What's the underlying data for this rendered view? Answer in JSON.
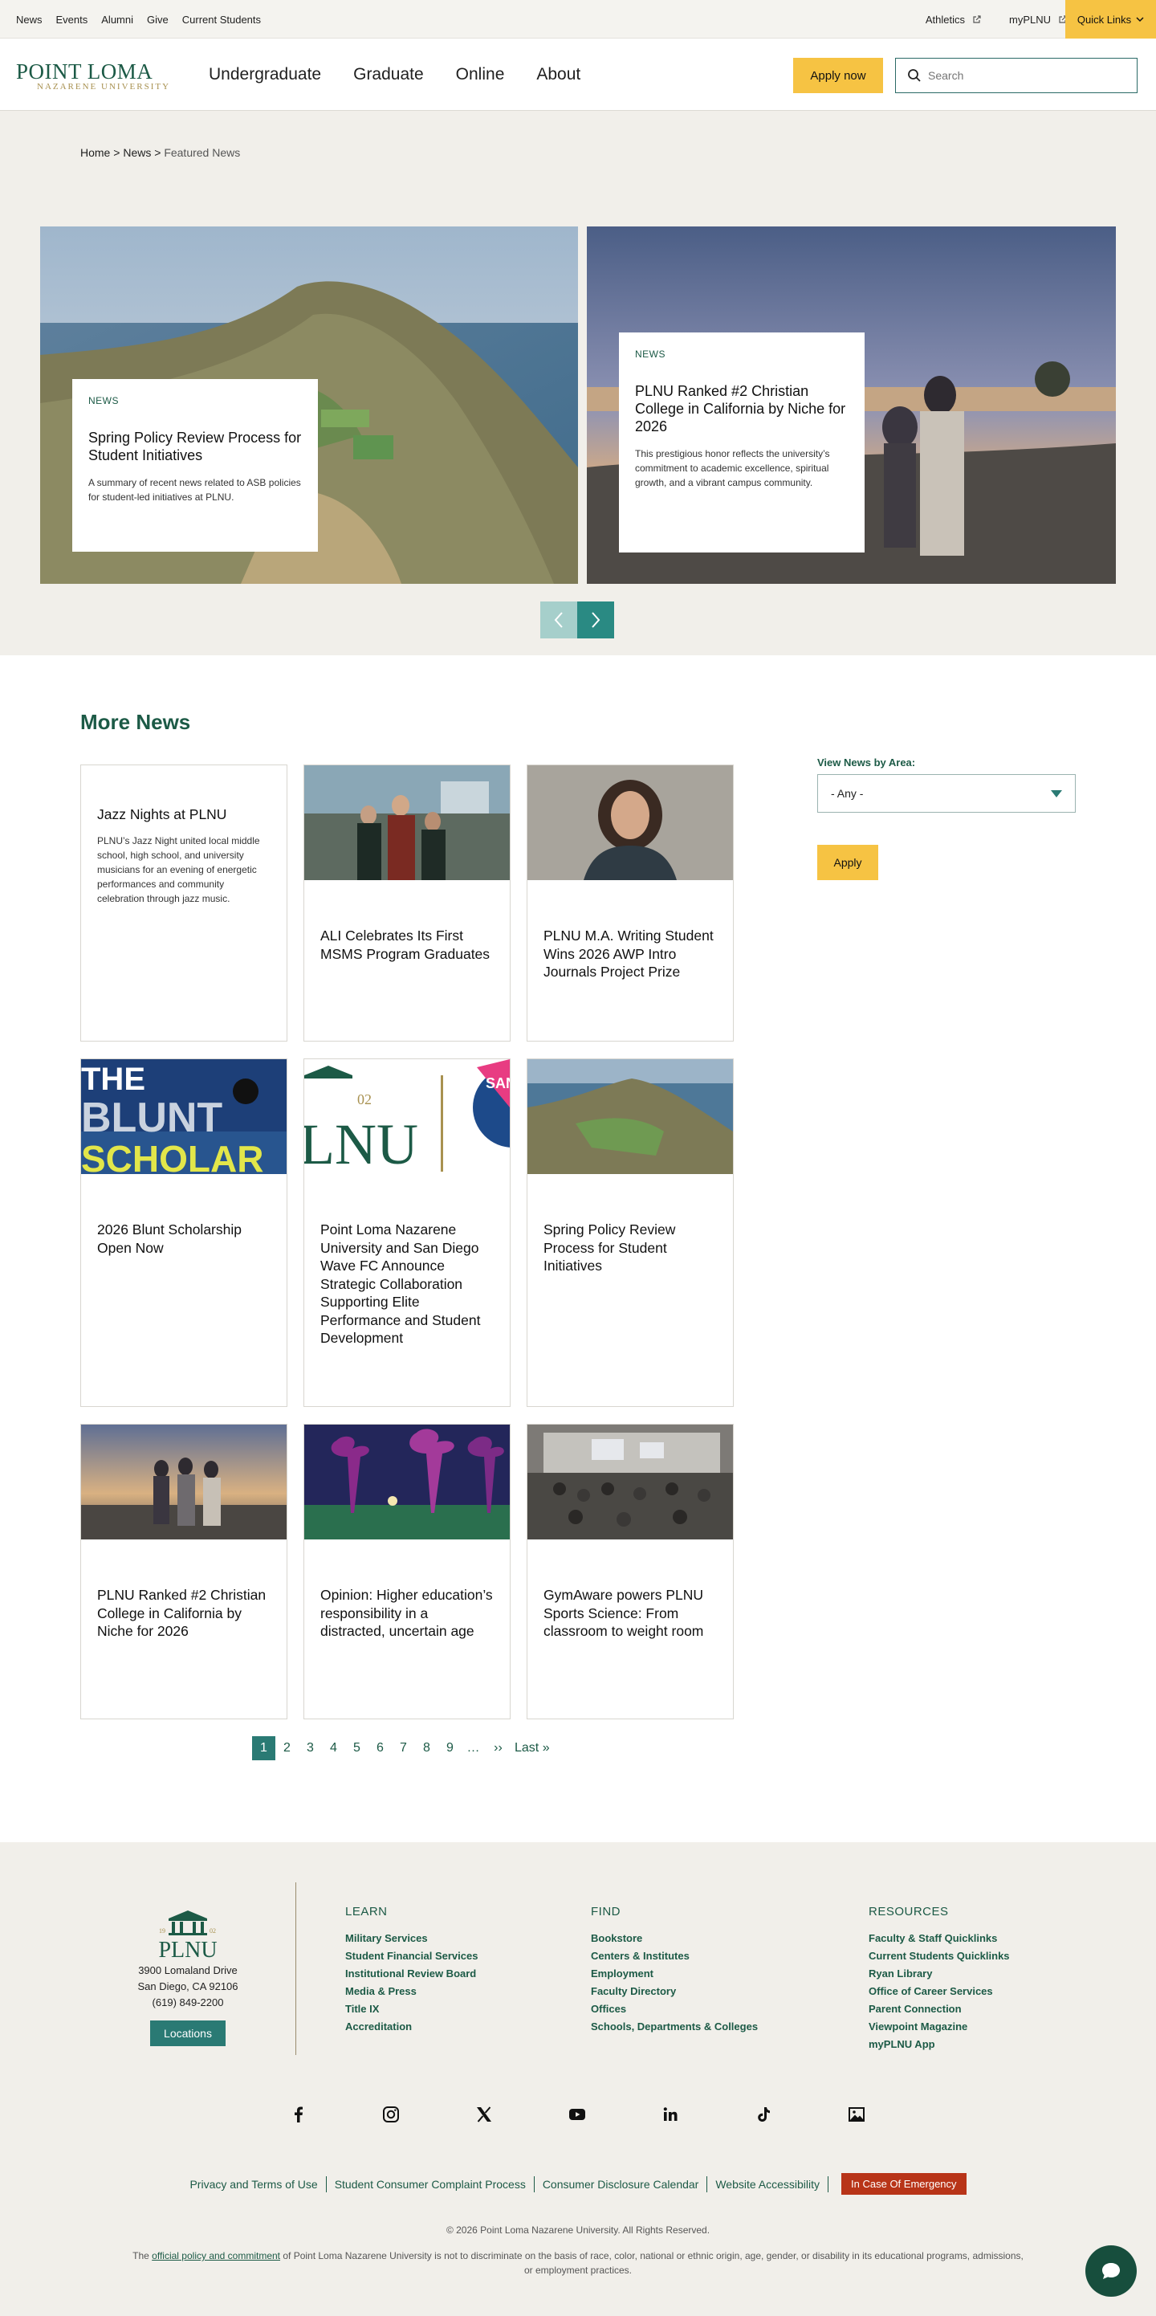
{
  "utility": {
    "links": [
      "News",
      "Events",
      "Alumni",
      "Give",
      "Current Students"
    ],
    "athletics": "Athletics",
    "myplnu": "myPLNU",
    "quick_links": "Quick Links"
  },
  "header": {
    "logo_main": "POINT LOMA",
    "logo_sub": "NAZARENE UNIVERSITY",
    "nav": [
      "Undergraduate",
      "Graduate",
      "Online",
      "About"
    ],
    "apply": "Apply now",
    "search_placeholder": "Search"
  },
  "breadcrumb": {
    "home": "Home",
    "news": "News",
    "current": "Featured News",
    "sep": ">"
  },
  "hero": [
    {
      "kicker": "NEWS",
      "title": "Spring Policy Review Process for Student Initiatives",
      "summary": "A summary of recent news related to ASB policies for student-led initiatives at PLNU."
    },
    {
      "kicker": "NEWS",
      "title": "PLNU Ranked #2 Christian College in California by Niche for 2026",
      "summary": "This prestigious honor reflects the university’s commitment to academic excellence, spiritual growth, and a vibrant campus community."
    }
  ],
  "more_news": {
    "title": "More News",
    "cards": [
      {
        "title": "Jazz Nights at PLNU",
        "summary": "PLNU’s Jazz Night united local middle school, high school, and university musicians for an evening of energetic performances and community celebration through jazz music."
      },
      {
        "title": "ALI Celebrates Its First MSMS Program Graduates"
      },
      {
        "title": "PLNU M.A. Writing Student Wins 2026 AWP Intro Journals Project Prize"
      },
      {
        "title": "2026 Blunt Scholarship Open Now",
        "thumb_text_1": "THE",
        "thumb_text_2": "BLUNT",
        "thumb_text_3": "SCHOLAR"
      },
      {
        "title": "Point Loma Nazarene University and San Diego Wave FC Announce Strategic Collaboration Supporting Elite Performance and Student Development",
        "thumb_text_1": "LNU",
        "thumb_text_2": "02",
        "thumb_text_3": "SAN"
      },
      {
        "title": "Spring Policy Review Process for Student Initiatives"
      },
      {
        "title": "PLNU Ranked #2 Christian College in California by Niche for 2026"
      },
      {
        "title": "Opinion: Higher education’s responsibility in a distracted, uncertain age"
      },
      {
        "title": "GymAware powers PLNU Sports Science: From classroom to weight room"
      }
    ],
    "filter_label": "View News by Area:",
    "filter_value": "- Any -",
    "filter_apply": "Apply",
    "pager": [
      "1",
      "2",
      "3",
      "4",
      "5",
      "6",
      "7",
      "8",
      "9",
      "…",
      "››",
      "Last »"
    ],
    "pager_active": "1"
  },
  "footer": {
    "logo": "PLNU",
    "logo_year_left": "19",
    "logo_year_right": "02",
    "address": [
      "3900 Lomaland Drive",
      "San Diego, CA 92106",
      "(619) 849-2200"
    ],
    "locations": "Locations",
    "learn": {
      "title": "LEARN",
      "links": [
        "Military Services",
        "Student Financial Services",
        "Institutional Review Board",
        "Media & Press",
        "Title IX",
        "Accreditation"
      ]
    },
    "find": {
      "title": "FIND",
      "links": [
        "Bookstore",
        "Centers & Institutes",
        "Employment",
        "Faculty Directory",
        "Offices",
        "Schools, Departments & Colleges"
      ]
    },
    "resources": {
      "title": "RESOURCES",
      "links": [
        "Faculty & Staff Quicklinks",
        "Current Students Quicklinks",
        "Ryan Library",
        "Office of Career Services",
        "Parent Connection",
        "Viewpoint Magazine",
        "myPLNU App"
      ]
    },
    "social": [
      "facebook-icon",
      "instagram-icon",
      "x-icon",
      "youtube-icon",
      "linkedin-icon",
      "tiktok-icon",
      "gallery-icon"
    ],
    "legal": [
      "Privacy and Terms of Use",
      "Student Consumer Complaint Process",
      "Consumer Disclosure Calendar",
      "Website Accessibility"
    ],
    "emergency": "In Case Of Emergency",
    "copyright": "© 2026 Point Loma Nazarene University. All Rights Reserved.",
    "policy_pre": "The",
    "policy_link": "official policy and commitment",
    "policy_post": "of Point Loma Nazarene University is not to discriminate on the basis of race, color, national or ethnic origin, age, gender, or disability in its educational programs, admissions, or employment practices."
  },
  "colors": {
    "brand_green": "#1c5a46",
    "teal": "#2a7a74",
    "gold": "#f6c343",
    "emergency": "#b83418"
  }
}
